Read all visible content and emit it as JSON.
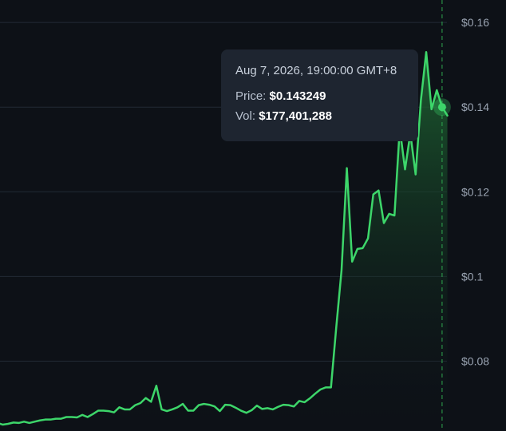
{
  "chart_data": {
    "type": "area",
    "y_axis_position": "right",
    "yticks": [
      {
        "value": 0.08,
        "label": "$0.08"
      },
      {
        "value": 0.1,
        "label": "$0.1"
      },
      {
        "value": 0.12,
        "label": "$0.12"
      },
      {
        "value": 0.14,
        "label": "$0.14"
      },
      {
        "value": 0.16,
        "label": "$0.16"
      }
    ],
    "ylim": [
      0.0635,
      0.1653
    ],
    "grid": true,
    "colors": {
      "line": "#3dd66a",
      "fill_top": "#1f6b34",
      "grid": "#222a35",
      "hover_line": "#2fa84f"
    },
    "series": [
      {
        "values": [
          0.0654,
          0.065,
          0.0652,
          0.0655,
          0.0654,
          0.0657,
          0.0654,
          0.0657,
          0.066,
          0.0662,
          0.0662,
          0.0664,
          0.0664,
          0.0668,
          0.0668,
          0.0667,
          0.0673,
          0.0668,
          0.0675,
          0.0683,
          0.0683,
          0.0682,
          0.0679,
          0.0691,
          0.0686,
          0.0686,
          0.0696,
          0.0701,
          0.0713,
          0.0704,
          0.0742,
          0.0686,
          0.0682,
          0.0686,
          0.0691,
          0.0699,
          0.0683,
          0.0683,
          0.0696,
          0.0699,
          0.0697,
          0.0693,
          0.0682,
          0.0697,
          0.0696,
          0.069,
          0.0683,
          0.0678,
          0.0684,
          0.0695,
          0.0687,
          0.0689,
          0.0686,
          0.0692,
          0.0697,
          0.0696,
          0.0693,
          0.0706,
          0.0703,
          0.0712,
          0.0723,
          0.0733,
          0.0738,
          0.0738,
          0.088,
          0.1015,
          0.1256,
          0.1035,
          0.1065,
          0.1067,
          0.109,
          0.1194,
          0.1203,
          0.1126,
          0.1148,
          0.1144,
          0.135,
          0.1253,
          0.1338,
          0.1241,
          0.1417,
          0.153,
          0.1395,
          0.144,
          0.14,
          0.138
        ]
      }
    ],
    "hover_index": 84
  },
  "tooltip": {
    "date": "Aug 7, 2026, 19:00:00 GMT+8",
    "price_label": "Price:",
    "price_value": "$0.143249",
    "vol_label": "Vol:",
    "vol_value": "$177,401,288"
  }
}
